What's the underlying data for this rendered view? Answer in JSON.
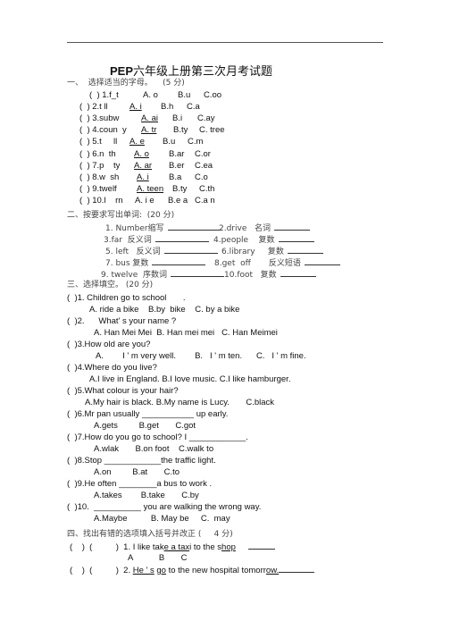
{
  "title": {
    "bold": "PEP",
    "rest": "六年级上册第三次月考试题"
  },
  "section1": {
    "heading": "一、  选择适当的字母。    (5 分)",
    "items": [
      {
        "q": "(  ) 1.f_t",
        "a": "A. o",
        "b": "B.u",
        "c": "C.oo"
      },
      {
        "q": "(  ) 2.t ll",
        "a": "A. i",
        "b": "B.h",
        "c": "C.a"
      },
      {
        "q": "(  ) 3.subw",
        "a": "A. ai",
        "b": "B.i",
        "c": "C.ay"
      },
      {
        "q": "(  ) 4.coun  y",
        "a": "A. tr",
        "b": "B.ty",
        "c": "C. tree"
      },
      {
        "q": "(  ) 5.t     ll",
        "a": "A. e",
        "b": "B.u",
        "c": "C.m"
      },
      {
        "q": "(  ) 6.n  th",
        "a": "A. o",
        "b": "B.ar",
        "c": "C.or"
      },
      {
        "q": "(  ) 7.p    ty",
        "a": "A. ar",
        "b": "B.er",
        "c": "C.ea"
      },
      {
        "q": "(  ) 8.w  sh",
        "a": "A. i",
        "b": "B.a",
        "c": "C.o"
      },
      {
        "q": "(  ) 9.twelf",
        "a": "A. teen",
        "b": "B.ty",
        "c": "C.th"
      },
      {
        "q": "(  ) 10.l    rn",
        "a": "A. i e",
        "b": "B.e a",
        "c": "C.a n"
      }
    ]
  },
  "section2": {
    "heading": "二、按要求写出单词:  (20 分)",
    "rows": [
      [
        "1. Number缩写",
        "2.drive   名词"
      ],
      [
        "3.far  反义词",
        "4.people    复数"
      ],
      [
        "5. left   反义词",
        "6.library     复数"
      ],
      [
        "7. bus 复数",
        "8.get  off       反义短语"
      ],
      [
        "9. twelve  序数词",
        "10.foot   复数"
      ]
    ]
  },
  "section3": {
    "heading": "三、选择填空。 (20 分)",
    "items": [
      {
        "q": "(  )1. Children go to school       .",
        "opts": "A. ride a bike    B.by  bike    C. by a bike"
      },
      {
        "q": "(  )2.      What' s your name ?",
        "opts": "A. Han Mei Mei  B. Han mei mei   C. Han Meimei"
      },
      {
        "q": "(  )3.How old are you?",
        "opts": "A.        I ' m very well.        B.   I ' m ten.      C.   I ' m fine."
      },
      {
        "q": "(  )4.Where do you live?",
        "opts": "A.I live in England. B.I love music. C.I like hamburger."
      },
      {
        "q": "(  )5.What colour is your hair?",
        "opts": "A.My hair is black. B.My name is Lucy.       C.black"
      },
      {
        "q": "(  )6.Mr pan usually ___________ up early.",
        "opts": "A.gets         B.get       C.got"
      },
      {
        "q": "(  )7.How do you go to school? I ____________.",
        "opts": "A.wlak       B.on foot    C.walk to"
      },
      {
        "q": "(  )8.Stop ____________the traffic light.",
        "opts": "A.on         B.at       C.to"
      },
      {
        "q": "(  )9.He often ________a bus to work .",
        "opts": "A.takes        B.take       C.by"
      },
      {
        "q": "(  )10.  __________ you are walking the wrong way.",
        "opts": "A.Maybe          B. May be     C.  may"
      }
    ]
  },
  "section4": {
    "heading": "四、找出有错的选项填入括号并改正 (     4 分)",
    "items": [
      {
        "prefix": "(    )  (          )  1. I like tak",
        "parts": [
          "e a tax",
          "i to the s",
          "hop"
        ],
        "letters": "A           B       C"
      },
      {
        "prefix": "(    )  (          )  2. ",
        "parts": [
          "He ' s",
          " ",
          "go",
          " to the new hospital tomorr",
          "ow."
        ]
      }
    ]
  }
}
